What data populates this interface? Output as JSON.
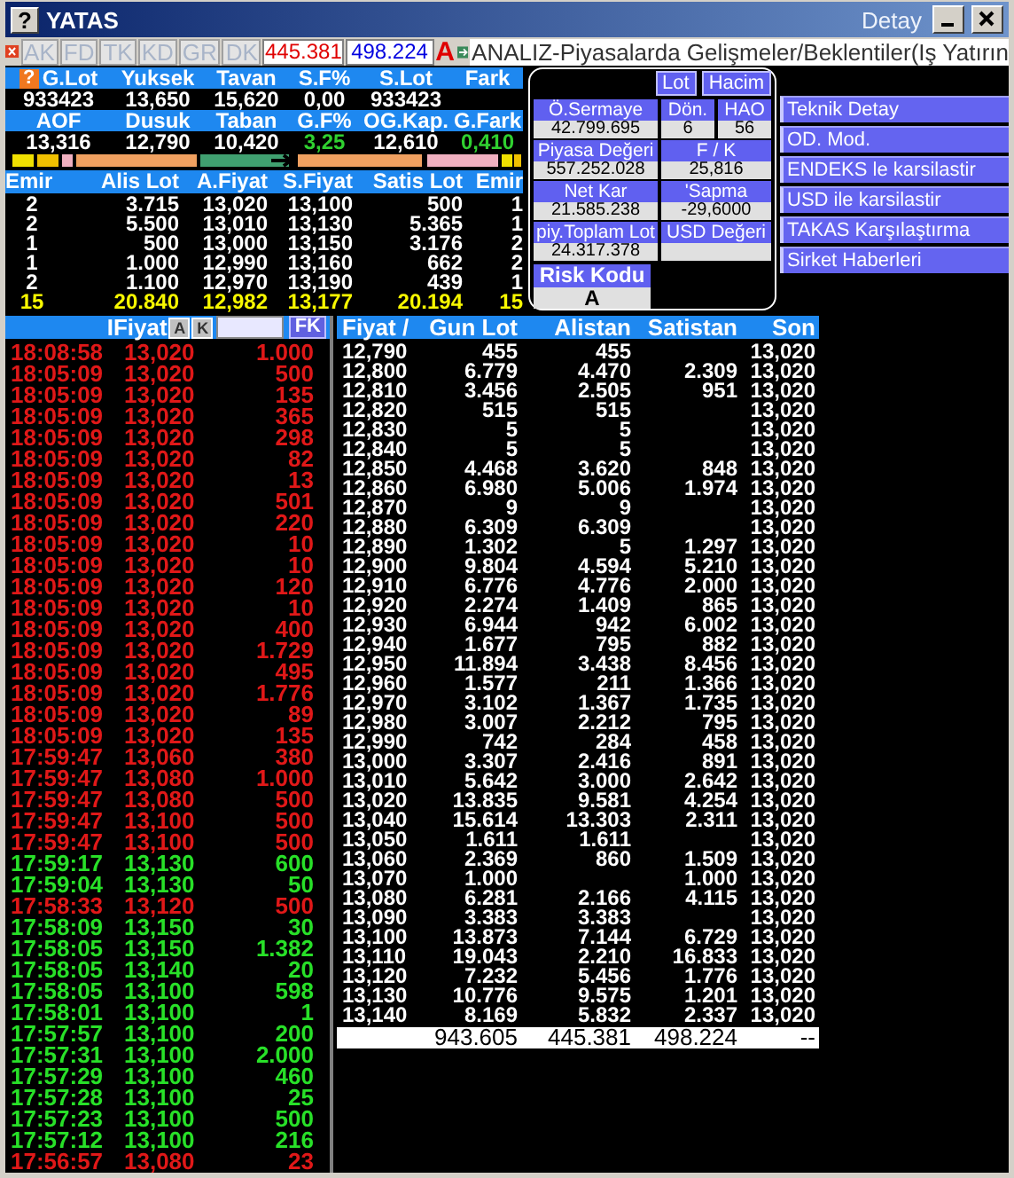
{
  "window": {
    "title": "YATAS",
    "help_glyph": "?",
    "subtitle": "Detay"
  },
  "toolbar": {
    "tabs": [
      {
        "label": "AK",
        "disabled": true
      },
      {
        "label": "FD",
        "disabled": true
      },
      {
        "label": "TK",
        "disabled": true
      },
      {
        "label": "KD",
        "disabled": true
      },
      {
        "label": "GR",
        "disabled": true
      },
      {
        "label": "DK",
        "disabled": true
      }
    ],
    "buy_total": "445.381",
    "sell_total": "498.224",
    "flag": "A",
    "ticker": "ANALIZ-Piyasalarda Gelişmeler/Beklentiler(Iş Yatırın"
  },
  "summary": {
    "help_glyph": "?",
    "rows": [
      {
        "headers": [
          "G.Lot",
          "Yuksek",
          "Tavan",
          "S.F%",
          "S.Lot",
          "Fark"
        ],
        "values": [
          {
            "text": "933423",
            "positive": false
          },
          {
            "text": "13,650",
            "positive": false
          },
          {
            "text": "15,620",
            "positive": false
          },
          {
            "text": "0,00",
            "positive": false
          },
          {
            "text": "933423",
            "positive": false
          }
        ]
      },
      {
        "headers": [
          "AOF",
          "Dusuk",
          "Taban",
          "G.F%",
          "OG.Kap.",
          "G.Fark"
        ],
        "values": [
          {
            "text": "13,316",
            "positive": false
          },
          {
            "text": "12,790",
            "positive": false
          },
          {
            "text": "10,420",
            "positive": false
          },
          {
            "text": "3,25",
            "positive": true
          },
          {
            "text": "12,610",
            "positive": false
          },
          {
            "text": "0,410",
            "positive": true
          }
        ]
      }
    ]
  },
  "order_book": {
    "columns": [
      "Emir",
      "Alis Lot",
      "A.Fiyat",
      "S.Fiyat",
      "Satis Lot",
      "Emir"
    ],
    "rows": [
      [
        "2",
        "3.715",
        "13,020",
        "13,100",
        "500",
        "1"
      ],
      [
        "2",
        "5.500",
        "13,010",
        "13,130",
        "5.365",
        "1"
      ],
      [
        "1",
        "500",
        "13,000",
        "13,150",
        "3.176",
        "2"
      ],
      [
        "1",
        "1.000",
        "12,990",
        "13,160",
        "662",
        "2"
      ],
      [
        "2",
        "1.100",
        "12,970",
        "13,190",
        "439",
        "1"
      ]
    ],
    "total": [
      "15",
      "20.840",
      "12,982",
      "13,177",
      "20.194",
      "15"
    ]
  },
  "detail_panel": {
    "toggles": [
      "Lot",
      "Hacim"
    ],
    "fields": [
      {
        "label": "Ö.Sermaye",
        "value": "42.799.695"
      },
      {
        "label": "Dön.",
        "value": "6"
      },
      {
        "label": "HAO",
        "value": "56"
      },
      {
        "label": "Piyasa Değeri",
        "value": "557.252.028"
      },
      {
        "label": "F / K",
        "value": "25,816"
      },
      {
        "label": "Net Kar",
        "value": "21.585.238"
      },
      {
        "label": "'Sapma",
        "value": "-29,6000"
      },
      {
        "label": "piy.Toplam Lot",
        "value": "24.317.378"
      },
      {
        "label": "USD Değeri"
      }
    ],
    "risk": {
      "label": "Risk Kodu",
      "value": "A"
    }
  },
  "links": [
    "Teknik Detay",
    "OD. Mod.",
    "ENDEKS le karsilastir",
    "USD ile karsilastir",
    "TAKAS Karşılaştırma",
    "Sirket Haberleri"
  ],
  "trades": {
    "header": "IFiyat",
    "buttons": [
      "A",
      "K"
    ],
    "filter_button": "FK",
    "rows": [
      {
        "time": "18:08:58",
        "price": "13,020",
        "lot": "1.000",
        "up": false
      },
      {
        "time": "18:05:09",
        "price": "13,020",
        "lot": "500",
        "up": false
      },
      {
        "time": "18:05:09",
        "price": "13,020",
        "lot": "135",
        "up": false
      },
      {
        "time": "18:05:09",
        "price": "13,020",
        "lot": "365",
        "up": false
      },
      {
        "time": "18:05:09",
        "price": "13,020",
        "lot": "298",
        "up": false
      },
      {
        "time": "18:05:09",
        "price": "13,020",
        "lot": "82",
        "up": false
      },
      {
        "time": "18:05:09",
        "price": "13,020",
        "lot": "13",
        "up": false
      },
      {
        "time": "18:05:09",
        "price": "13,020",
        "lot": "501",
        "up": false
      },
      {
        "time": "18:05:09",
        "price": "13,020",
        "lot": "220",
        "up": false
      },
      {
        "time": "18:05:09",
        "price": "13,020",
        "lot": "10",
        "up": false
      },
      {
        "time": "18:05:09",
        "price": "13,020",
        "lot": "10",
        "up": false
      },
      {
        "time": "18:05:09",
        "price": "13,020",
        "lot": "120",
        "up": false
      },
      {
        "time": "18:05:09",
        "price": "13,020",
        "lot": "10",
        "up": false
      },
      {
        "time": "18:05:09",
        "price": "13,020",
        "lot": "400",
        "up": false
      },
      {
        "time": "18:05:09",
        "price": "13,020",
        "lot": "1.729",
        "up": false
      },
      {
        "time": "18:05:09",
        "price": "13,020",
        "lot": "495",
        "up": false
      },
      {
        "time": "18:05:09",
        "price": "13,020",
        "lot": "1.776",
        "up": false
      },
      {
        "time": "18:05:09",
        "price": "13,020",
        "lot": "89",
        "up": false
      },
      {
        "time": "18:05:09",
        "price": "13,020",
        "lot": "135",
        "up": false
      },
      {
        "time": "17:59:47",
        "price": "13,060",
        "lot": "380",
        "up": false
      },
      {
        "time": "17:59:47",
        "price": "13,080",
        "lot": "1.000",
        "up": false
      },
      {
        "time": "17:59:47",
        "price": "13,080",
        "lot": "500",
        "up": false
      },
      {
        "time": "17:59:47",
        "price": "13,100",
        "lot": "500",
        "up": false
      },
      {
        "time": "17:59:47",
        "price": "13,100",
        "lot": "500",
        "up": false
      },
      {
        "time": "17:59:17",
        "price": "13,130",
        "lot": "600",
        "up": true
      },
      {
        "time": "17:59:04",
        "price": "13,130",
        "lot": "50",
        "up": true
      },
      {
        "time": "17:58:33",
        "price": "13,120",
        "lot": "500",
        "up": false
      },
      {
        "time": "17:58:09",
        "price": "13,150",
        "lot": "30",
        "up": true
      },
      {
        "time": "17:58:05",
        "price": "13,150",
        "lot": "1.382",
        "up": true
      },
      {
        "time": "17:58:05",
        "price": "13,140",
        "lot": "20",
        "up": true
      },
      {
        "time": "17:58:05",
        "price": "13,100",
        "lot": "598",
        "up": true
      },
      {
        "time": "17:58:01",
        "price": "13,100",
        "lot": "1",
        "up": true
      },
      {
        "time": "17:57:57",
        "price": "13,100",
        "lot": "200",
        "up": true
      },
      {
        "time": "17:57:31",
        "price": "13,100",
        "lot": "2.000",
        "up": true
      },
      {
        "time": "17:57:29",
        "price": "13,100",
        "lot": "460",
        "up": true
      },
      {
        "time": "17:57:28",
        "price": "13,100",
        "lot": "25",
        "up": true
      },
      {
        "time": "17:57:23",
        "price": "13,100",
        "lot": "500",
        "up": true
      },
      {
        "time": "17:57:12",
        "price": "13,100",
        "lot": "216",
        "up": true
      },
      {
        "time": "17:56:57",
        "price": "13,080",
        "lot": "23",
        "up": false
      }
    ]
  },
  "price_table": {
    "columns": [
      "Fiyat /",
      "Gun Lot",
      "Alistan",
      "Satistan",
      "Son"
    ],
    "rows": [
      {
        "price": "12,790",
        "gun_lot": "455",
        "alistan": "455",
        "son": "13,020"
      },
      {
        "price": "12,800",
        "gun_lot": "6.779",
        "alistan": "4.470",
        "satistan": "2.309",
        "son": "13,020"
      },
      {
        "price": "12,810",
        "gun_lot": "3.456",
        "alistan": "2.505",
        "satistan": "951",
        "son": "13,020"
      },
      {
        "price": "12,820",
        "gun_lot": "515",
        "alistan": "515",
        "son": "13,020"
      },
      {
        "price": "12,830",
        "gun_lot": "5",
        "alistan": "5",
        "son": "13,020"
      },
      {
        "price": "12,840",
        "gun_lot": "5",
        "alistan": "5",
        "son": "13,020"
      },
      {
        "price": "12,850",
        "gun_lot": "4.468",
        "alistan": "3.620",
        "satistan": "848",
        "son": "13,020"
      },
      {
        "price": "12,860",
        "gun_lot": "6.980",
        "alistan": "5.006",
        "satistan": "1.974",
        "son": "13,020"
      },
      {
        "price": "12,870",
        "gun_lot": "9",
        "alistan": "9",
        "son": "13,020"
      },
      {
        "price": "12,880",
        "gun_lot": "6.309",
        "alistan": "6.309",
        "son": "13,020"
      },
      {
        "price": "12,890",
        "gun_lot": "1.302",
        "alistan": "5",
        "satistan": "1.297",
        "son": "13,020"
      },
      {
        "price": "12,900",
        "gun_lot": "9.804",
        "alistan": "4.594",
        "satistan": "5.210",
        "son": "13,020"
      },
      {
        "price": "12,910",
        "gun_lot": "6.776",
        "alistan": "4.776",
        "satistan": "2.000",
        "son": "13,020"
      },
      {
        "price": "12,920",
        "gun_lot": "2.274",
        "alistan": "1.409",
        "satistan": "865",
        "son": "13,020"
      },
      {
        "price": "12,930",
        "gun_lot": "6.944",
        "alistan": "942",
        "satistan": "6.002",
        "son": "13,020"
      },
      {
        "price": "12,940",
        "gun_lot": "1.677",
        "alistan": "795",
        "satistan": "882",
        "son": "13,020"
      },
      {
        "price": "12,950",
        "gun_lot": "11.894",
        "alistan": "3.438",
        "satistan": "8.456",
        "son": "13,020"
      },
      {
        "price": "12,960",
        "gun_lot": "1.577",
        "alistan": "211",
        "satistan": "1.366",
        "son": "13,020"
      },
      {
        "price": "12,970",
        "gun_lot": "3.102",
        "alistan": "1.367",
        "satistan": "1.735",
        "son": "13,020"
      },
      {
        "price": "12,980",
        "gun_lot": "3.007",
        "alistan": "2.212",
        "satistan": "795",
        "son": "13,020"
      },
      {
        "price": "12,990",
        "gun_lot": "742",
        "alistan": "284",
        "satistan": "458",
        "son": "13,020"
      },
      {
        "price": "13,000",
        "gun_lot": "3.307",
        "alistan": "2.416",
        "satistan": "891",
        "son": "13,020"
      },
      {
        "price": "13,010",
        "gun_lot": "5.642",
        "alistan": "3.000",
        "satistan": "2.642",
        "son": "13,020"
      },
      {
        "price": "13,020",
        "gun_lot": "13.835",
        "alistan": "9.581",
        "satistan": "4.254",
        "son": "13,020"
      },
      {
        "price": "13,040",
        "gun_lot": "15.614",
        "alistan": "13.303",
        "satistan": "2.311",
        "son": "13,020"
      },
      {
        "price": "13,050",
        "gun_lot": "1.611",
        "alistan": "1.611",
        "son": "13,020"
      },
      {
        "price": "13,060",
        "gun_lot": "2.369",
        "alistan": "860",
        "satistan": "1.509",
        "son": "13,020"
      },
      {
        "price": "13,070",
        "gun_lot": "1.000",
        "satistan": "1.000",
        "son": "13,020"
      },
      {
        "price": "13,080",
        "gun_lot": "6.281",
        "alistan": "2.166",
        "satistan": "4.115",
        "son": "13,020"
      },
      {
        "price": "13,090",
        "gun_lot": "3.383",
        "alistan": "3.383",
        "son": "13,020"
      },
      {
        "price": "13,100",
        "gun_lot": "13.873",
        "alistan": "7.144",
        "satistan": "6.729",
        "son": "13,020"
      },
      {
        "price": "13,110",
        "gun_lot": "19.043",
        "alistan": "2.210",
        "satistan": "16.833",
        "son": "13,020"
      },
      {
        "price": "13,120",
        "gun_lot": "7.232",
        "alistan": "5.456",
        "satistan": "1.776",
        "son": "13,020"
      },
      {
        "price": "13,130",
        "gun_lot": "10.776",
        "alistan": "9.575",
        "satistan": "1.201",
        "son": "13,020"
      },
      {
        "price": "13,140",
        "gun_lot": "8.169",
        "alistan": "5.832",
        "satistan": "2.337",
        "son": "13,020"
      }
    ],
    "totals": {
      "gun_lot": "943.605",
      "alistan": "445.381",
      "satistan": "498.224",
      "son": "--"
    }
  }
}
